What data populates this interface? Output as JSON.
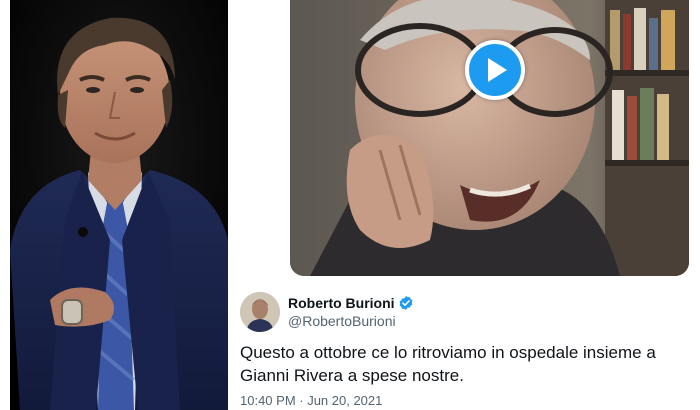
{
  "tweet": {
    "display_name": "Roberto Burioni",
    "handle": "@RobertoBurioni",
    "verified": true,
    "text": "Questo a ottobre ce lo ritroviamo in ospedale insieme a Gianni Rivera a spese nostre.",
    "timestamp": "10:40 PM · Jun 20, 2021",
    "video": {
      "play_icon": "play-icon",
      "accent_color": "#1d9bf0"
    }
  },
  "colors": {
    "text_primary": "#0f1419",
    "text_secondary": "#536471",
    "verified": "#1d9bf0"
  }
}
